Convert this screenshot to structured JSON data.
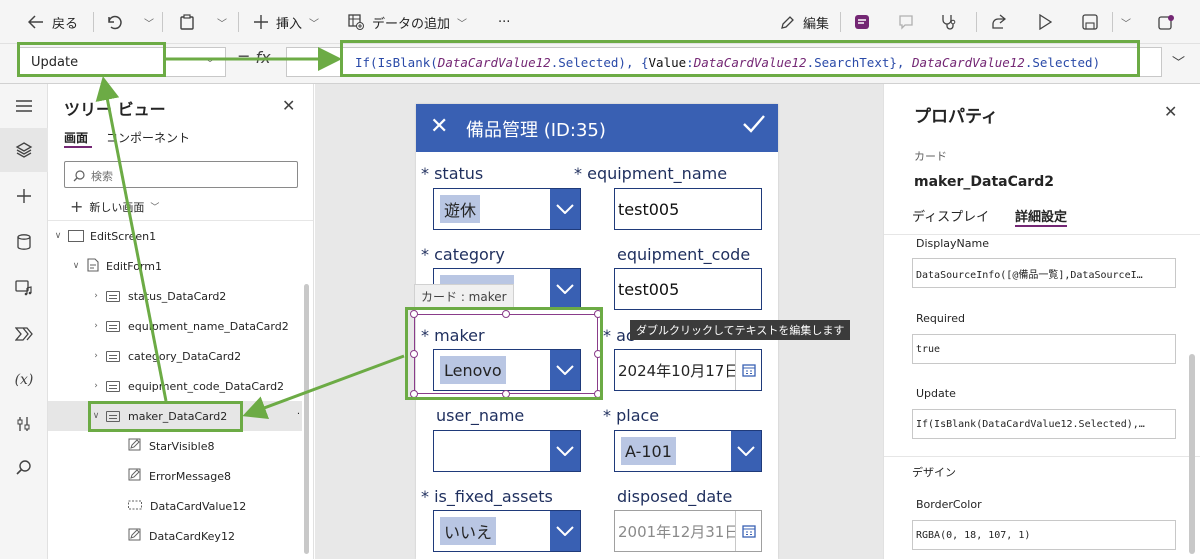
{
  "toolbar": {
    "back_label": "戻る",
    "insert_label": "挿入",
    "add_data_label": "データの追加",
    "more_label": "···",
    "edit_label": "編集"
  },
  "formula_bar": {
    "property": "Update",
    "fx": "fx",
    "formula_parts": [
      {
        "text": "If(IsBlank(",
        "italic": false
      },
      {
        "text": "DataCardValue12",
        "italic": true
      },
      {
        "text": ".Selected), {",
        "italic": false
      },
      {
        "text": "Value",
        "italic": false
      },
      {
        "text": ":",
        "italic": false
      },
      {
        "text": "DataCardValue12",
        "italic": true
      },
      {
        "text": ".SearchText}, ",
        "italic": false
      },
      {
        "text": "DataCardValue12",
        "italic": true
      },
      {
        "text": ".Selected)",
        "italic": false
      }
    ]
  },
  "tree": {
    "title": "ツリー ビュー",
    "tab_screens": "画面",
    "tab_components": "コンポーネント",
    "search_placeholder": "検索",
    "new_screen": "新しい画面",
    "items": [
      {
        "label": "EditScreen1"
      },
      {
        "label": "EditForm1"
      },
      {
        "label": "status_DataCard2"
      },
      {
        "label": "equipment_name_DataCard2"
      },
      {
        "label": "category_DataCard2"
      },
      {
        "label": "equipment_code_DataCard2"
      },
      {
        "label": "maker_DataCard2"
      },
      {
        "label": "StarVisible8"
      },
      {
        "label": "ErrorMessage8"
      },
      {
        "label": "DataCardValue12"
      },
      {
        "label": "DataCardKey12"
      }
    ]
  },
  "form": {
    "title": "備品管理 (ID:35)",
    "fields": {
      "status": {
        "label": "status",
        "value": "遊休"
      },
      "equipment_name": {
        "label": "equipment_name",
        "value": "test005"
      },
      "category": {
        "label": "category",
        "value": ""
      },
      "equipment_code": {
        "label": "equipment_code",
        "value": "test005"
      },
      "maker": {
        "label": "maker",
        "value": "Lenovo"
      },
      "acquired": {
        "label": "ac",
        "value": "2024年10月17日"
      },
      "user_name": {
        "label": "user_name",
        "value": ""
      },
      "place": {
        "label": "place",
        "value": "A-101"
      },
      "is_fixed_assets": {
        "label": "is_fixed_assets",
        "value": "いいえ"
      },
      "disposed_date": {
        "label": "disposed_date",
        "value": "2001年12月31日"
      }
    },
    "required_mark": "*",
    "card_tooltip": "カード : maker",
    "edit_tooltip": "ダブルクリックしてテキストを編集します"
  },
  "properties": {
    "title": "プロパティ",
    "type_label": "カード",
    "control_name": "maker_DataCard2",
    "tab_display": "ディスプレイ",
    "tab_advanced": "詳細設定",
    "displayname_label": "DisplayName",
    "displayname_value": "DataSourceInfo([@備品一覧],DataSourceI…",
    "required_label": "Required",
    "required_value": "true",
    "update_label": "Update",
    "update_value": "If(IsBlank(DataCardValue12.Selected),…",
    "design_label": "デザイン",
    "bordercolor_label": "BorderColor",
    "bordercolor_value": "RGBA(0, 18, 107, 1)"
  },
  "colors": {
    "accent": "#742774",
    "form_header": "#3960b3",
    "annotation": "#6cab45"
  }
}
